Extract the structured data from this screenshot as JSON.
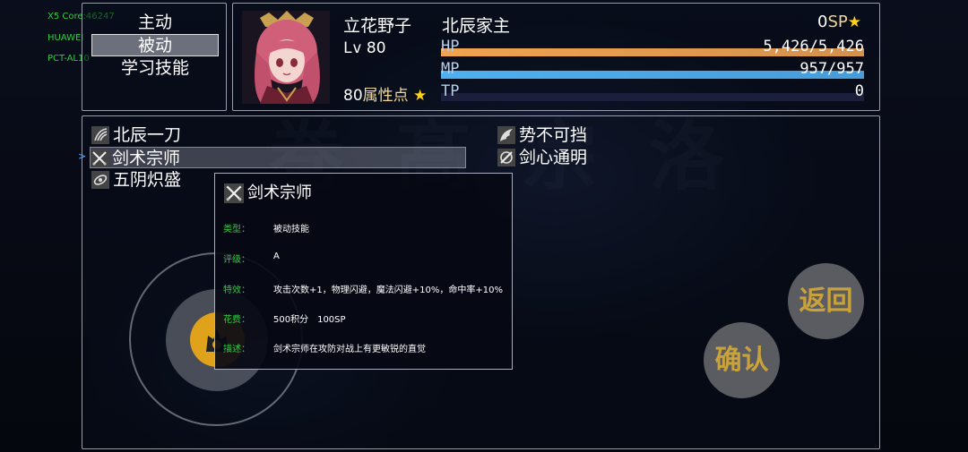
{
  "system": {
    "lines": [
      "X5 Core:46247",
      "HUAWEI",
      "PCT-AL10"
    ]
  },
  "menu": {
    "items": [
      {
        "label": "主动",
        "selected": false
      },
      {
        "label": "被动",
        "selected": true
      },
      {
        "label": "学习技能",
        "selected": false
      }
    ]
  },
  "actor": {
    "name": "立花野子",
    "level_label": "Lv",
    "level": "80",
    "class_name": "北辰家主",
    "attr_points": "80",
    "attr_label": "属性点",
    "sp_value": "0",
    "sp_label": "SP",
    "hp": {
      "label": "HP",
      "value": "5,426/5,426",
      "fraction": 1.0,
      "color": "#f0a350"
    },
    "mp": {
      "label": "MP",
      "value": "957/957",
      "fraction": 1.0,
      "color": "#4fb0f0"
    },
    "tp": {
      "label": "TP",
      "value": "0",
      "fraction": 0.0,
      "color": "#6a8f3a"
    }
  },
  "skills": [
    {
      "name": "北辰一刀",
      "icon": "wind-slash-icon",
      "selected": false
    },
    {
      "name": "剑术宗师",
      "icon": "crossed-swords-icon",
      "selected": true
    },
    {
      "name": "五阴炽盛",
      "icon": "fire-swirl-icon",
      "selected": false
    },
    {
      "name": "势不可挡",
      "icon": "wing-icon",
      "selected": false
    },
    {
      "name": "剑心通明",
      "icon": "sword-heart-icon",
      "selected": false
    }
  ],
  "help": {
    "title": "剑术宗师",
    "rows": [
      {
        "key": "类型：",
        "value": "被动技能"
      },
      {
        "key": "评级：",
        "value": "A"
      },
      {
        "key": "特效：",
        "value": "攻击次数+1，物理闪避，魔法闪避+10%，命中率+10%"
      },
      {
        "key": "花费：",
        "value": "500积分　100SP"
      },
      {
        "key": "描述：",
        "value": "剑术宗师在攻防对战上有更敏锐的直觉"
      }
    ]
  },
  "buttons": {
    "back": "返回",
    "confirm": "确认"
  },
  "colors": {
    "accent_gold": "#f1d79a",
    "help_key": "#2ecc40",
    "cursor": "#4aa8ff"
  }
}
